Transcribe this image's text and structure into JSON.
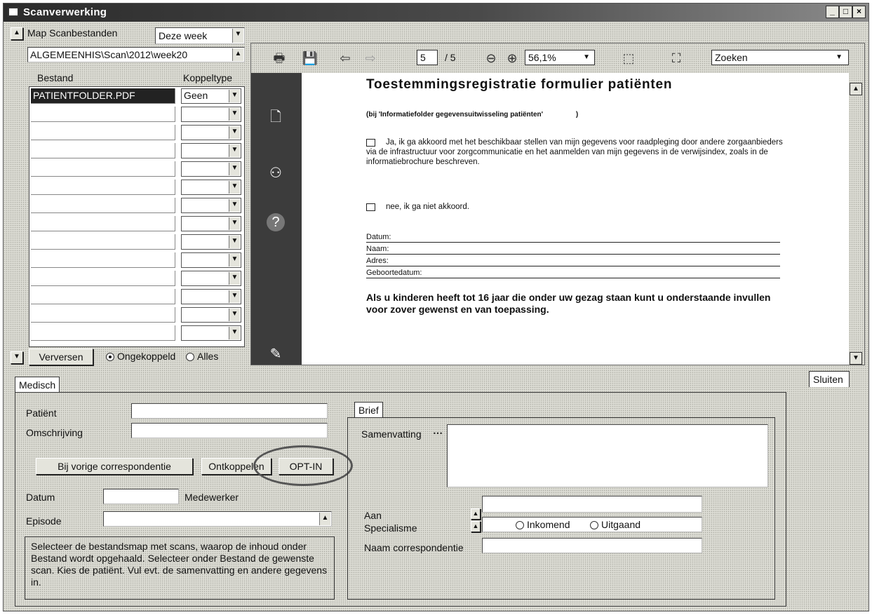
{
  "window": {
    "title": "Scanverwerking",
    "min_label": "_",
    "max_label": "□",
    "close_label": "×"
  },
  "scan": {
    "map_label": "Map Scanbestanden",
    "period_value": "Deze week",
    "path_value": "ALGEMEENHIS\\Scan\\2012\\week20",
    "col_bestand": "Bestand",
    "col_koppeltype": "Koppeltype",
    "rows": [
      {
        "bestand": "PATIENTFOLDER.PDF",
        "koppeltype": "Geen"
      },
      {
        "bestand": "",
        "koppeltype": ""
      },
      {
        "bestand": "",
        "koppeltype": ""
      },
      {
        "bestand": "",
        "koppeltype": ""
      },
      {
        "bestand": "",
        "koppeltype": ""
      },
      {
        "bestand": "",
        "koppeltype": ""
      },
      {
        "bestand": "",
        "koppeltype": ""
      },
      {
        "bestand": "",
        "koppeltype": ""
      },
      {
        "bestand": "",
        "koppeltype": ""
      },
      {
        "bestand": "",
        "koppeltype": ""
      },
      {
        "bestand": "",
        "koppeltype": ""
      },
      {
        "bestand": "",
        "koppeltype": ""
      },
      {
        "bestand": "",
        "koppeltype": ""
      },
      {
        "bestand": "",
        "koppeltype": ""
      }
    ],
    "refresh_label": "Verversen",
    "radio_ongekoppeld": "Ongekoppeld",
    "radio_alles": "Alles"
  },
  "viewer": {
    "page_current": "5",
    "page_sep": "/ 5",
    "zoom": "56,1%",
    "search_placeholder": "Zoeken",
    "doc": {
      "title": "Toestemmingsregistratie formulier patiënten",
      "subtitle": "(bij 'Informatiefolder gegevensuitwisseling patiënten'",
      "subtitle_end": ")",
      "option_yes": "Ja, ik ga akkoord met het beschikbaar stellen van mijn gegevens voor raadpleging door andere zorgaanbieders via de infrastructuur voor zorgcommunicatie en het aanmelden van mijn gegevens in de verwijsindex, zoals in de informatiebrochure beschreven.",
      "option_no": "nee, ik ga niet akkoord.",
      "field_datum": "Datum:",
      "field_naam": "Naam:",
      "field_adres": "Adres:",
      "field_geboortedatum": "Geboortedatum:",
      "children_text": "Als u kinderen heeft tot 16 jaar die onder uw gezag staan kunt u onderstaande invullen voor zover gewenst en van toepassing."
    }
  },
  "sluiten_label": "Sluiten",
  "medisch": {
    "tab_label": "Medisch",
    "patient_label": "Patiënt",
    "patient_value": "",
    "omschrijving_label": "Omschrijving",
    "omschrijving_value": "",
    "bij_vorige_label": "Bij vorige correspondentie",
    "ontkoppelen_label": "Ontkoppelen",
    "optin_label": "OPT-IN",
    "datum_label": "Datum",
    "datum_value": "",
    "medewerker_label": "Medewerker",
    "episode_label": "Episode",
    "episode_value": "",
    "help_text": "Selecteer de bestandsmap met scans, waarop de inhoud onder Bestand wordt opgehaald. Selecteer onder Bestand de gewenste scan. Kies de patiënt. Vul evt. de samenvatting en andere gegevens in."
  },
  "brief": {
    "tab_label": "Brief",
    "samenvatting_label": "Samenvatting",
    "samenvatting_value": "",
    "aan_label": "Aan",
    "aan_value": "",
    "specialisme_label": "Specialisme",
    "specialisme_value": "",
    "radio_inkomend": "Inkomend",
    "radio_uitgaand": "Uitgaand",
    "naam_corr_label": "Naam correspondentie",
    "naam_corr_value": ""
  }
}
